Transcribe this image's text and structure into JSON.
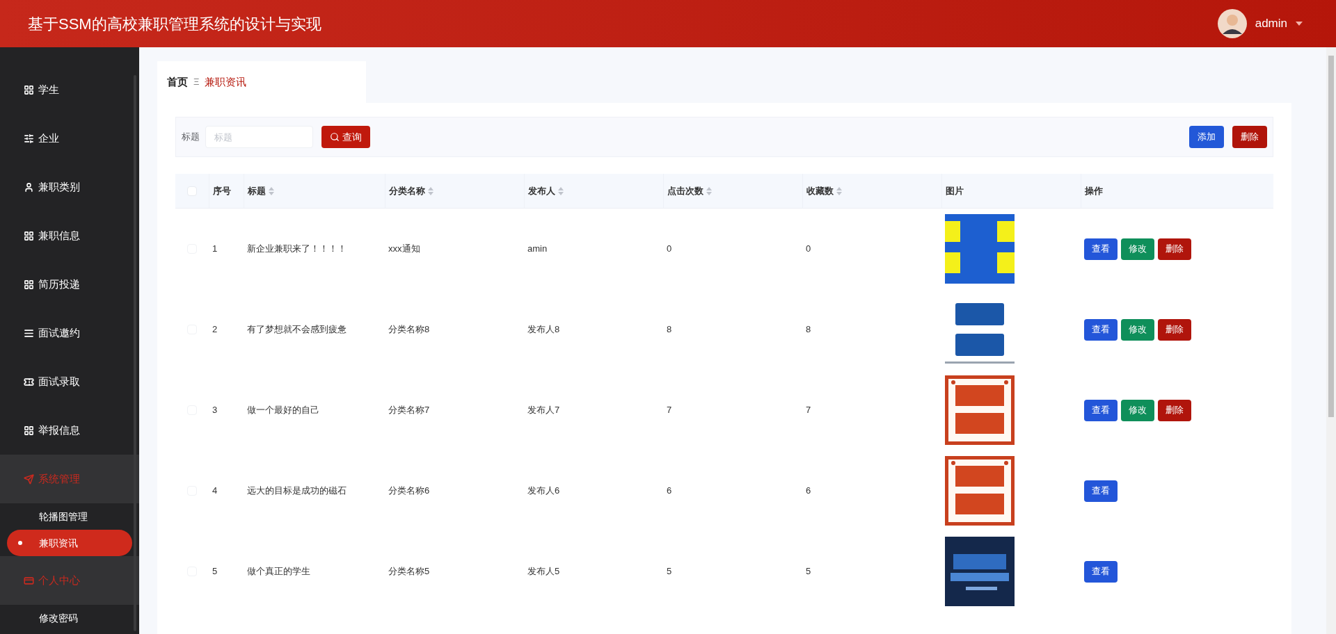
{
  "header": {
    "title": "基于SSM的高校兼职管理系统的设计与实现",
    "user": "admin"
  },
  "sidebar": {
    "items": [
      {
        "label": "学生",
        "highlighted": false
      },
      {
        "label": "企业",
        "highlighted": false
      },
      {
        "label": "兼职类别",
        "highlighted": false
      },
      {
        "label": "兼职信息",
        "highlighted": false
      },
      {
        "label": "简历投递",
        "highlighted": false
      },
      {
        "label": "面试邀约",
        "highlighted": false
      },
      {
        "label": "面试录取",
        "highlighted": false
      },
      {
        "label": "举报信息",
        "highlighted": false
      },
      {
        "label": "系统管理",
        "expanded": true,
        "highlighted": true,
        "children": [
          {
            "label": "轮播图管理",
            "selected": false
          },
          {
            "label": "兼职资讯",
            "selected": true
          }
        ]
      },
      {
        "label": "个人中心",
        "expanded": true,
        "highlighted": true,
        "children": [
          {
            "label": "修改密码",
            "selected": false
          }
        ]
      }
    ]
  },
  "breadcrumb": {
    "home": "首页",
    "separator": "Ξ",
    "current": "兼职资讯"
  },
  "search": {
    "label": "标题",
    "placeholder": "标题",
    "button": "查询",
    "add_button": "添加",
    "delete_button": "删除"
  },
  "table": {
    "select_all_checked": false,
    "columns": [
      {
        "label": "序号",
        "sortable": false
      },
      {
        "label": "标题",
        "sortable": true
      },
      {
        "label": "分类名称",
        "sortable": true
      },
      {
        "label": "发布人",
        "sortable": true
      },
      {
        "label": "点击次数",
        "sortable": true
      },
      {
        "label": "收藏数",
        "sortable": true
      },
      {
        "label": "图片",
        "sortable": false
      },
      {
        "label": "操作",
        "sortable": false
      }
    ],
    "rows": [
      {
        "checked": false,
        "cells": [
          "1",
          "新企业兼职来了！！！！",
          "xxx通知",
          "amin",
          "0",
          "0"
        ],
        "actions": [
          {
            "kind": "view",
            "label": "查看"
          },
          {
            "kind": "edit",
            "label": "修改"
          },
          {
            "kind": "delete",
            "label": "删除"
          }
        ]
      },
      {
        "checked": false,
        "cells": [
          "2",
          "有了梦想就不会感到疲惫",
          "分类名称8",
          "发布人8",
          "8",
          "8"
        ],
        "actions": [
          {
            "kind": "view",
            "label": "查看"
          },
          {
            "kind": "edit",
            "label": "修改"
          },
          {
            "kind": "delete",
            "label": "删除"
          }
        ]
      },
      {
        "checked": false,
        "cells": [
          "3",
          "做一个最好的自己",
          "分类名称7",
          "发布人7",
          "7",
          "7"
        ],
        "actions": [
          {
            "kind": "view",
            "label": "查看"
          },
          {
            "kind": "edit",
            "label": "修改"
          },
          {
            "kind": "delete",
            "label": "删除"
          }
        ]
      },
      {
        "checked": false,
        "cells": [
          "4",
          "远大的目标是成功的磁石",
          "分类名称6",
          "发布人6",
          "6",
          "6"
        ],
        "actions": [
          {
            "kind": "view",
            "label": "查看"
          }
        ]
      },
      {
        "checked": false,
        "cells": [
          "5",
          "做个真正的学生",
          "分类名称5",
          "发布人5",
          "5",
          "5"
        ],
        "actions": [
          {
            "kind": "view",
            "label": "查看"
          }
        ]
      }
    ]
  }
}
